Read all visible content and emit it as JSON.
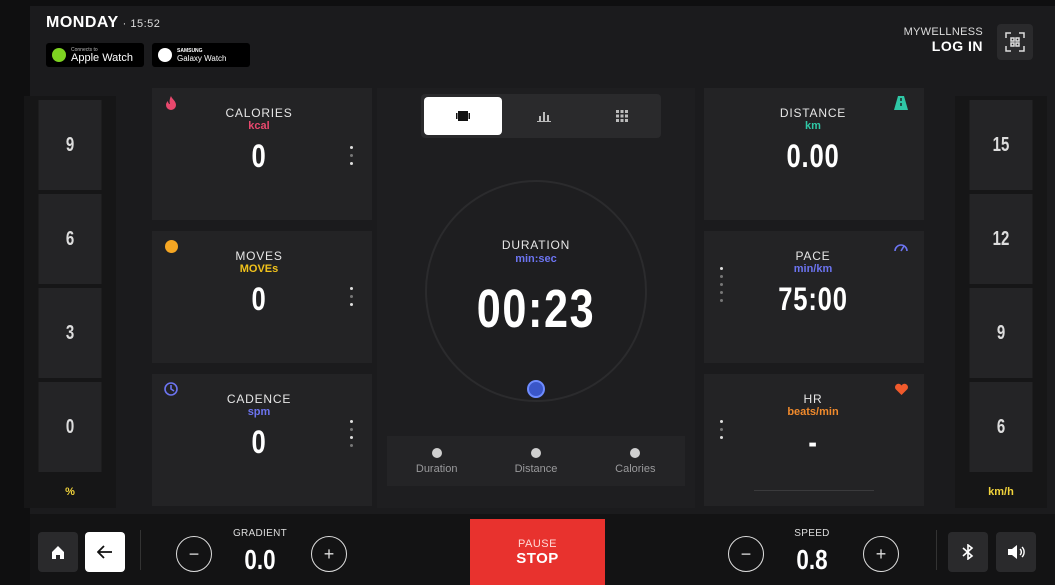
{
  "header": {
    "day": "MONDAY",
    "time": "· 15:52",
    "apple_watch": {
      "small": "Connects to",
      "big": "Apple Watch"
    },
    "samsung": {
      "small": "SAMSUNG",
      "big": "Galaxy Watch"
    },
    "mywellness": "MYWELLNESS",
    "login": "LOG IN",
    "qr_icon": "qr-code-icon"
  },
  "gradient_scale": {
    "levels": [
      "9",
      "6",
      "3",
      "0"
    ],
    "unit": "%"
  },
  "speed_scale": {
    "levels": [
      "15",
      "12",
      "9",
      "6"
    ],
    "unit": "km/h"
  },
  "tiles": {
    "calories": {
      "name": "CALORIES",
      "unit": "kcal",
      "value": "0",
      "unit_color": "#e8486d",
      "icon": "flame-icon",
      "icon_color": "#e8486d"
    },
    "moves": {
      "name": "MOVES",
      "unit": "MOVEs",
      "value": "0",
      "unit_color": "#f1c21b",
      "icon": "moves-dot-icon",
      "icon_color": "#f5a623"
    },
    "cadence": {
      "name": "CADENCE",
      "unit": "spm",
      "value": "0",
      "unit_color": "#6c74f0",
      "icon": "cadence-icon",
      "icon_color": "#6c74f0"
    },
    "distance": {
      "name": "DISTANCE",
      "unit": "km",
      "value": "0.00",
      "unit_color": "#2fc7a6",
      "icon": "road-icon",
      "icon_color": "#2fc7a6"
    },
    "pace": {
      "name": "PACE",
      "unit": "min/km",
      "value": "75:00",
      "unit_color": "#6c74f0",
      "icon": "gauge-icon",
      "icon_color": "#6c74f0"
    },
    "hr": {
      "name": "HR",
      "unit": "beats/min",
      "value": "-",
      "unit_color": "#f08a2c",
      "icon": "heart-icon",
      "icon_color": "#f05a2c"
    }
  },
  "center": {
    "tabs": [
      "single-view-icon",
      "chart-view-icon",
      "grid-view-icon"
    ],
    "duration_name": "DURATION",
    "duration_unit": "min:sec",
    "duration_value": "00:23",
    "targets": [
      "Duration",
      "Distance",
      "Calories"
    ]
  },
  "bottom": {
    "gradient_label": "GRADIENT",
    "gradient_value": "0.0",
    "speed_label": "SPEED",
    "speed_value": "0.8",
    "pause_label": "PAUSE",
    "stop_label": "STOP",
    "minus": "−",
    "plus": "+"
  }
}
